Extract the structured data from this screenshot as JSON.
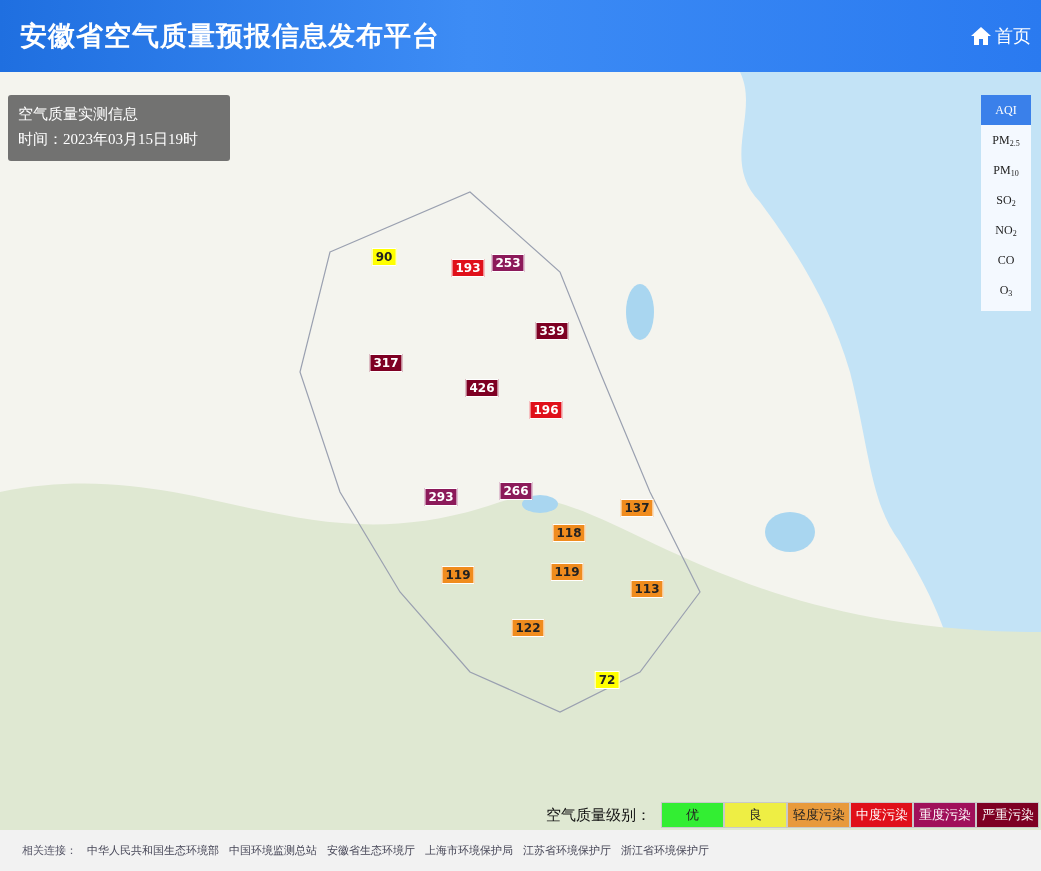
{
  "header": {
    "title": "安徽省空气质量预报信息发布平台",
    "home_link": "首页"
  },
  "info_box": {
    "title": "空气质量实测信息",
    "time": "时间：2023年03月15日19时"
  },
  "pollutant_tabs": [
    {
      "label": "AQI",
      "selected": true
    },
    {
      "label": "PM$_{2.5}$",
      "selected": false
    },
    {
      "label": "PM$_{10}$",
      "selected": false
    },
    {
      "label": "SO$_{2}$",
      "selected": false
    },
    {
      "label": "NO$_{2}$",
      "selected": false
    },
    {
      "label": "CO",
      "selected": false
    },
    {
      "label": "O$_{3}$",
      "selected": false
    }
  ],
  "markers": [
    {
      "value": "90",
      "color": "#ffff00"
    },
    {
      "value": "193",
      "color": "#e0101a"
    },
    {
      "value": "253",
      "color": "#8c1a5a"
    },
    {
      "value": "339",
      "color": "#7e0023"
    },
    {
      "value": "317",
      "color": "#7e0023"
    },
    {
      "value": "426",
      "color": "#7e0023"
    },
    {
      "value": "196",
      "color": "#e0101a"
    },
    {
      "value": "293",
      "color": "#8c1a5a"
    },
    {
      "value": "266",
      "color": "#8c1a5a"
    },
    {
      "value": "137",
      "color": "#f08c1e"
    },
    {
      "value": "118",
      "color": "#f08c1e"
    },
    {
      "value": "119",
      "color": "#f08c1e"
    },
    {
      "value": "119",
      "color": "#f08c1e"
    },
    {
      "value": "113",
      "color": "#f08c1e"
    },
    {
      "value": "122",
      "color": "#f08c1e"
    },
    {
      "value": "72",
      "color": "#ffff00"
    }
  ],
  "legend": {
    "label": "空气质量级别：",
    "levels": [
      {
        "label": "优",
        "color": "#33ee33"
      },
      {
        "label": "良",
        "color": "#eeee44"
      },
      {
        "label": "轻度污染",
        "color": "#e89a3c"
      },
      {
        "label": "中度污染",
        "color": "#e0101a"
      },
      {
        "label": "重度污染",
        "color": "#a0105a"
      },
      {
        "label": "严重污染",
        "color": "#7e0023"
      }
    ]
  },
  "footer": {
    "label": "相关连接：",
    "links": [
      "中华人民共和国生态环境部",
      "中国环境监测总站",
      "安徽省生态环境厅",
      "上海市环境保护局",
      "江苏省环境保护厅",
      "浙江省环境保护厅"
    ]
  }
}
